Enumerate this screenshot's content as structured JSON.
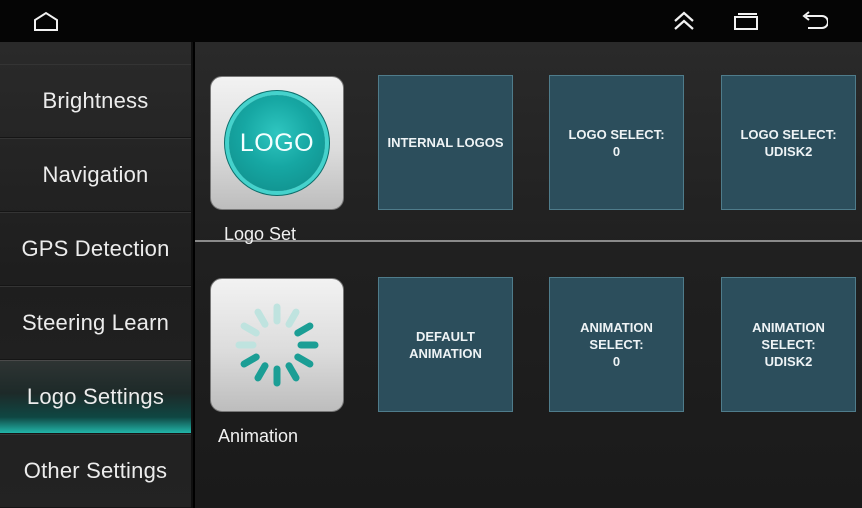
{
  "status_bar": {
    "icons": [
      "home-icon",
      "expand-up-icon",
      "recent-apps-icon",
      "back-icon"
    ]
  },
  "sidebar": {
    "items": [
      {
        "label": "Brightness",
        "active": false
      },
      {
        "label": "Navigation",
        "active": false
      },
      {
        "label": "GPS Detection",
        "active": false
      },
      {
        "label": "Steering Learn",
        "active": false
      },
      {
        "label": "Logo Settings",
        "active": true
      },
      {
        "label": "Other Settings",
        "active": false
      }
    ]
  },
  "logo_section": {
    "label": "Logo Set",
    "logo_text": "LOGO",
    "options": [
      "INTERNAL LOGOS",
      "LOGO SELECT:\n0",
      "LOGO SELECT:\nUDISK2"
    ]
  },
  "animation_section": {
    "label": "Animation",
    "icon": "loading-spinner-icon",
    "options": [
      "DEFAULT\nANIMATION",
      "ANIMATION\nSELECT:\n0",
      "ANIMATION\nSELECT:\nUDISK2"
    ]
  },
  "colors": {
    "accent": "#22b6a9",
    "tile": "#2c4e5c",
    "spinner_dark": "#1b9e95",
    "spinner_light": "#bfe3df"
  }
}
